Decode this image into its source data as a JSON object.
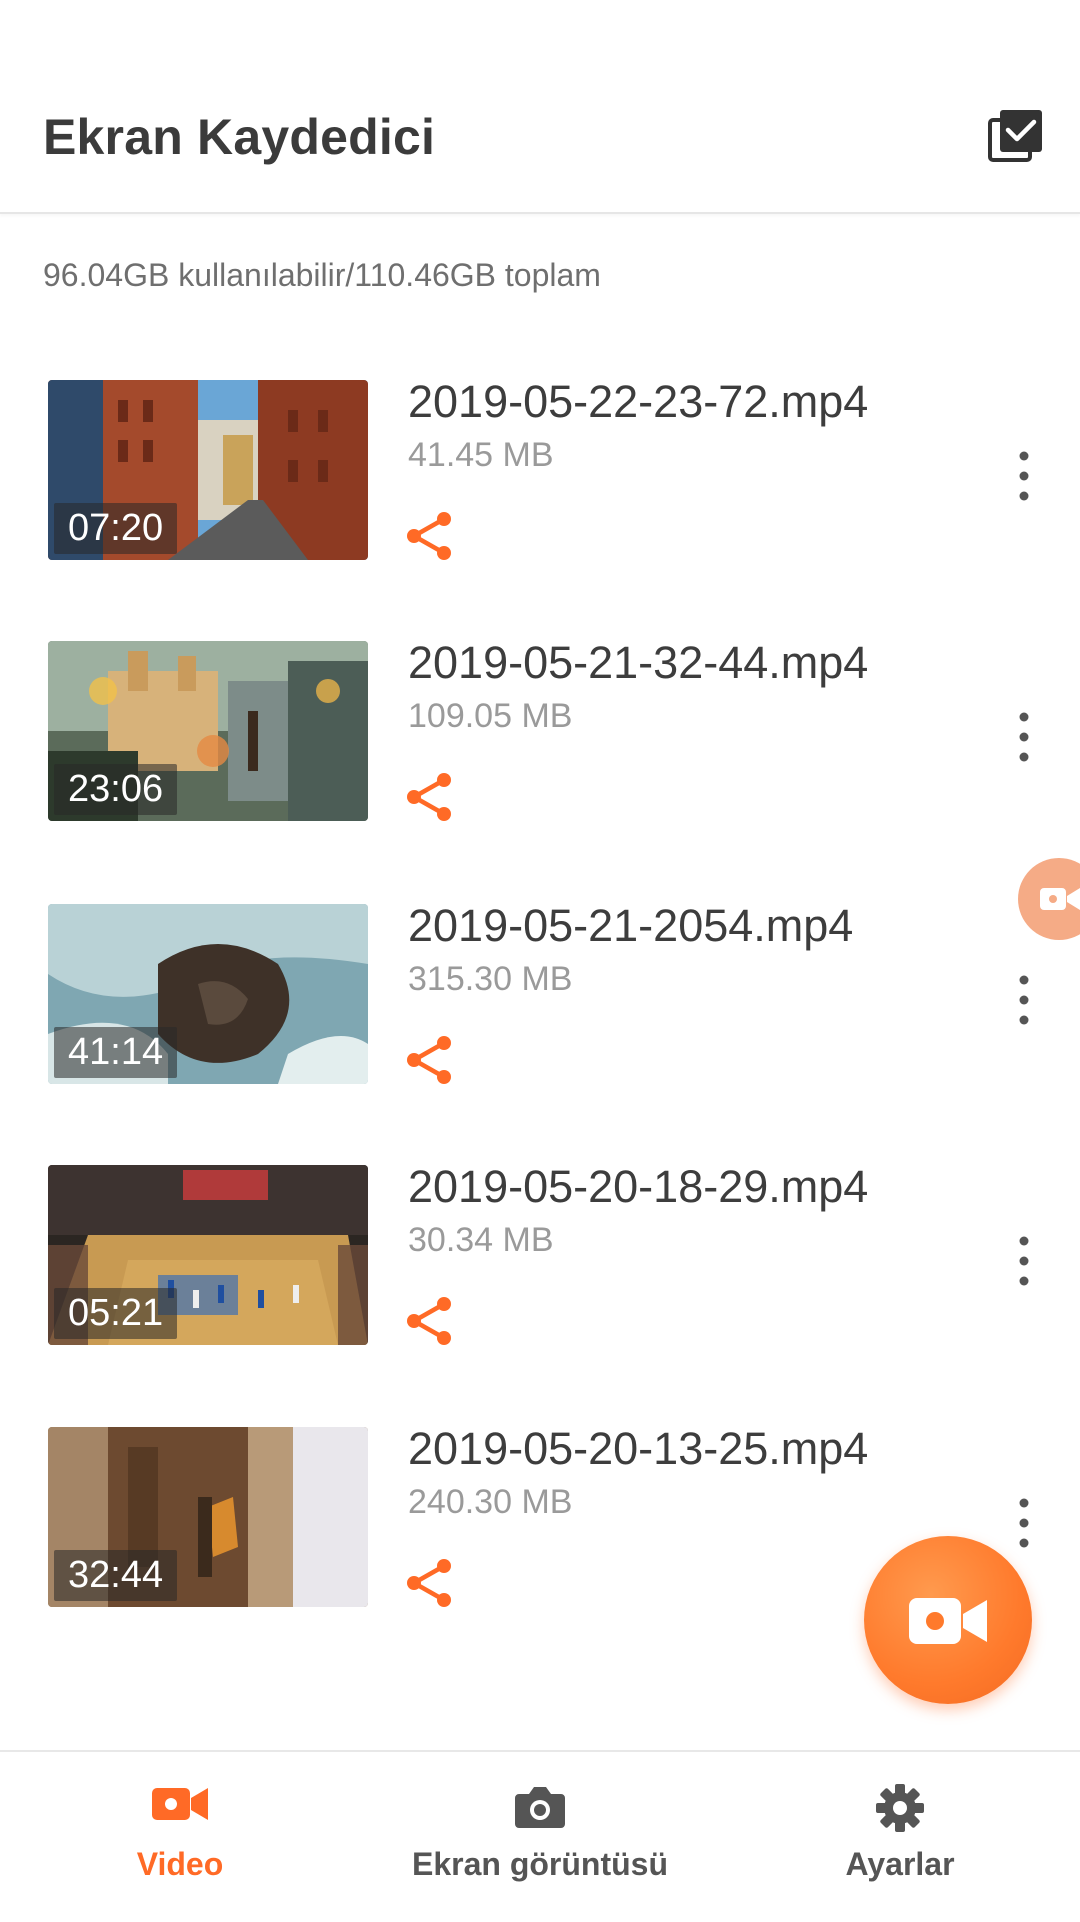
{
  "appbar": {
    "title": "Ekran Kaydedici",
    "select_icon": "select-all-icon"
  },
  "storage": {
    "text": "96.04GB kullanılabilir/110.46GB toplam"
  },
  "videos": [
    {
      "name": "2019-05-22-23-72.mp4",
      "size": "41.45 MB",
      "duration": "07:20",
      "thumb": "city-street"
    },
    {
      "name": "2019-05-21-32-44.mp4",
      "size": "109.05 MB",
      "duration": "23:06",
      "thumb": "fantasy-castle"
    },
    {
      "name": "2019-05-21-2054.mp4",
      "size": "315.30 MB",
      "duration": "41:14",
      "thumb": "ocean-rocks"
    },
    {
      "name": "2019-05-20-18-29.mp4",
      "size": "30.34 MB",
      "duration": "05:21",
      "thumb": "basketball-court"
    },
    {
      "name": "2019-05-20-13-25.mp4",
      "size": "240.30 MB",
      "duration": "32:44",
      "thumb": "old-wall"
    }
  ],
  "bottom_nav": [
    {
      "label": "Video",
      "icon": "video-camera-icon",
      "active": true
    },
    {
      "label": "Ekran görüntüsü",
      "icon": "camera-icon",
      "active": false
    },
    {
      "label": "Ayarlar",
      "icon": "gear-icon",
      "active": false
    }
  ],
  "colors": {
    "accent": "#ff6a26",
    "title": "#3b3b3b",
    "secondary": "#9a9a9a"
  }
}
